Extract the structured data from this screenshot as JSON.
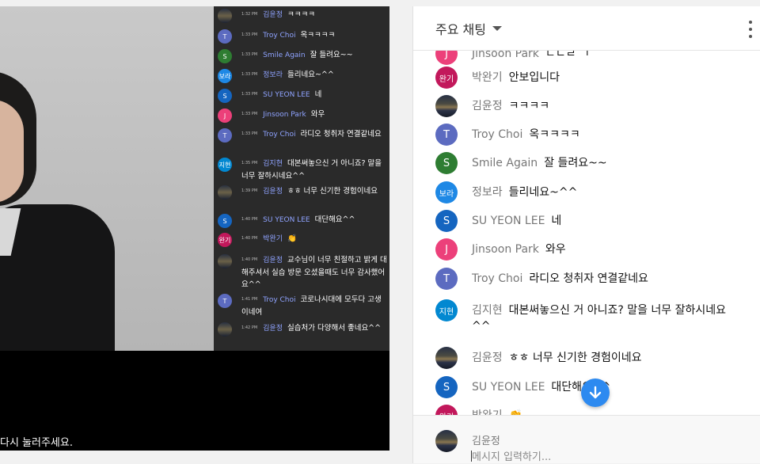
{
  "video": {
    "caption": "다시 눌러주세요.",
    "overlay_messages": [
      {
        "time": "1:32 PM",
        "name": "김윤정",
        "text": "ㅋㅋㅋㅋ",
        "avatar": "photo"
      },
      {
        "time": "1:33 PM",
        "name": "Troy Choi",
        "text": "옥ㅋㅋㅋㅋ",
        "avatar": "T",
        "color": "#5c6bc0"
      },
      {
        "time": "1:33 PM",
        "name": "Smile Again",
        "text": "잘 들려요~~",
        "avatar": "S",
        "color": "#2e7d32"
      },
      {
        "time": "1:33 PM",
        "name": "정보라",
        "text": "들리네요~^^",
        "avatar": "보라",
        "color": "#1e88e5"
      },
      {
        "time": "1:33 PM",
        "name": "SU YEON LEE",
        "text": "네",
        "avatar": "S",
        "color": "#1565c0"
      },
      {
        "time": "1:33 PM",
        "name": "Jinsoon Park",
        "text": "와우",
        "avatar": "J",
        "color": "#ec407a"
      },
      {
        "time": "1:33 PM",
        "name": "Troy Choi",
        "text": "라디오 청취자 연결같네요",
        "avatar": "T",
        "color": "#5c6bc0"
      },
      {
        "time": "1:35 PM",
        "name": "김지현",
        "text": "대본써놓으신 거 아니죠? 말을 너무 잘하시네요^^",
        "avatar": "지현",
        "color": "#0288d1"
      },
      {
        "time": "1:39 PM",
        "name": "김윤정",
        "text": "ㅎㅎ 너무 신기한 경험이네요",
        "avatar": "photo"
      },
      {
        "time": "1:40 PM",
        "name": "SU YEON LEE",
        "text": "대단해요^^",
        "avatar": "S",
        "color": "#1565c0"
      },
      {
        "time": "1:40 PM",
        "name": "박완기",
        "text": "👏",
        "avatar": "완기",
        "color": "#c2185b"
      },
      {
        "time": "1:40 PM",
        "name": "김윤정",
        "text": "교수님이 너무 친절하고 밝게 대해주셔서 실습 방문 오셨을때도 너무 감사했어요^^",
        "avatar": "photo"
      },
      {
        "time": "1:41 PM",
        "name": "Troy Choi",
        "text": "코로나시대에 모두다 고생이네여",
        "avatar": "T",
        "color": "#5c6bc0"
      },
      {
        "time": "1:42 PM",
        "name": "김윤정",
        "text": "실습처가 다양해서 좋네요^^",
        "avatar": "photo"
      }
    ]
  },
  "chat": {
    "title": "주요 채팅",
    "partial_top": {
      "name": "Jinsoon Park",
      "text": "ㄷㄴㄹ ㄱ",
      "avatar": "J",
      "color": "#ec407a"
    },
    "messages": [
      {
        "name": "박완기",
        "text": "안보입니다",
        "avatar": "완기",
        "color": "#c2185b"
      },
      {
        "name": "김윤정",
        "text": "ㅋㅋㅋㅋ",
        "avatar": "photo"
      },
      {
        "name": "Troy Choi",
        "text": "옥ㅋㅋㅋㅋ",
        "avatar": "T",
        "color": "#5c6bc0"
      },
      {
        "name": "Smile Again",
        "text": "잘 들려요~~",
        "avatar": "S",
        "color": "#2e7d32"
      },
      {
        "name": "정보라",
        "text": "들리네요~^^",
        "avatar": "보라",
        "color": "#1e88e5"
      },
      {
        "name": "SU YEON LEE",
        "text": "네",
        "avatar": "S",
        "color": "#1565c0"
      },
      {
        "name": "Jinsoon Park",
        "text": "와우",
        "avatar": "J",
        "color": "#ec407a"
      },
      {
        "name": "Troy Choi",
        "text": "라디오 청취자 연결같네요",
        "avatar": "T",
        "color": "#5c6bc0"
      },
      {
        "name": "김지현",
        "text": "대본써놓으신 거 아니죠? 말을 너무 잘하시네요^^",
        "avatar": "지현",
        "color": "#0288d1"
      },
      {
        "name": "김윤정",
        "text": "ㅎㅎ 너무 신기한 경험이네요",
        "avatar": "photo"
      },
      {
        "name": "SU YEON LEE",
        "text": "대단해요^^",
        "avatar": "S",
        "color": "#1565c0"
      },
      {
        "name": "박완기",
        "text": "👏",
        "avatar": "완기",
        "color": "#c2185b"
      }
    ],
    "composer": {
      "name": "김윤정",
      "placeholder": "메시지 입력하기..."
    },
    "accent_color": "#2d8af0"
  }
}
